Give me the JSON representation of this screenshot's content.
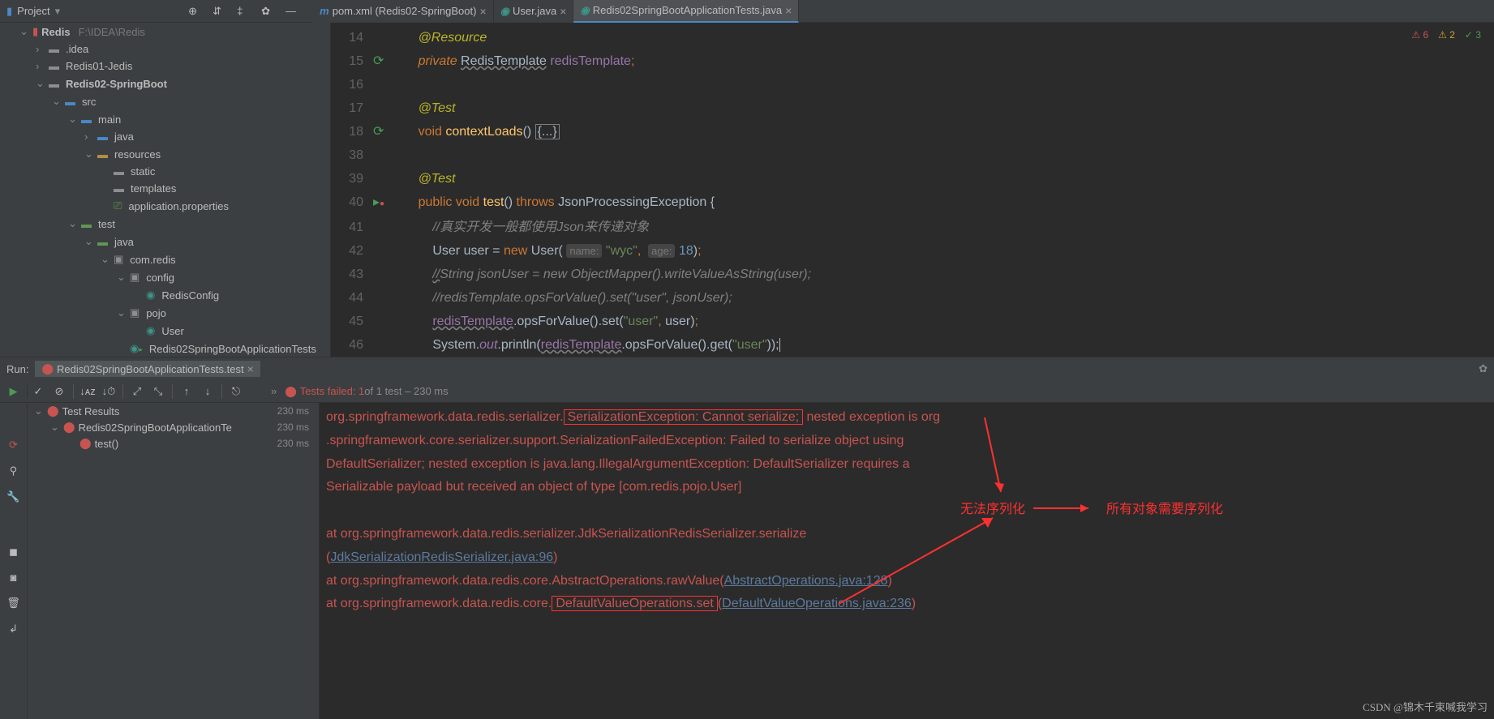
{
  "header": {
    "project_label": "Project"
  },
  "editor_tabs": [
    {
      "icon": "m",
      "label": "pom.xml (Redis02-SpringBoot)",
      "active": false
    },
    {
      "icon": "c",
      "label": "User.java",
      "active": false
    },
    {
      "icon": "c",
      "label": "Redis02SpringBootApplicationTests.java",
      "active": true
    }
  ],
  "tree": {
    "root": "Redis",
    "root_path": "F:\\IDEA\\Redis",
    "items": [
      {
        "indent": 2,
        "arrow": "›",
        "icon": "folder",
        "label": ".idea"
      },
      {
        "indent": 2,
        "arrow": "›",
        "icon": "folder",
        "label": "Redis01-Jedis"
      },
      {
        "indent": 2,
        "arrow": "⌄",
        "icon": "folder",
        "label": "Redis02-SpringBoot",
        "bold": true
      },
      {
        "indent": 3,
        "arrow": "⌄",
        "icon": "folder-blue",
        "label": "src"
      },
      {
        "indent": 4,
        "arrow": "⌄",
        "icon": "folder-blue",
        "label": "main"
      },
      {
        "indent": 5,
        "arrow": "›",
        "icon": "folder-blue",
        "label": "java"
      },
      {
        "indent": 5,
        "arrow": "⌄",
        "icon": "folder-gold",
        "label": "resources"
      },
      {
        "indent": 6,
        "arrow": "",
        "icon": "folder",
        "label": "static"
      },
      {
        "indent": 6,
        "arrow": "",
        "icon": "folder",
        "label": "templates"
      },
      {
        "indent": 6,
        "arrow": "",
        "icon": "prop",
        "label": "application.properties"
      },
      {
        "indent": 4,
        "arrow": "⌄",
        "icon": "folder-green",
        "label": "test"
      },
      {
        "indent": 5,
        "arrow": "⌄",
        "icon": "folder-green",
        "label": "java"
      },
      {
        "indent": 6,
        "arrow": "⌄",
        "icon": "pkg",
        "label": "com.redis"
      },
      {
        "indent": 7,
        "arrow": "⌄",
        "icon": "pkg",
        "label": "config"
      },
      {
        "indent": 8,
        "arrow": "",
        "icon": "class",
        "label": "RedisConfig"
      },
      {
        "indent": 7,
        "arrow": "⌄",
        "icon": "pkg",
        "label": "pojo"
      },
      {
        "indent": 8,
        "arrow": "",
        "icon": "class",
        "label": "User"
      },
      {
        "indent": 7,
        "arrow": "",
        "icon": "class-run",
        "label": "Redis02SpringBootApplicationTests"
      }
    ]
  },
  "inspections": {
    "errors": "6",
    "warnings": "2",
    "oks": "3"
  },
  "code_lines": [
    {
      "n": 14,
      "html": "<span class='kw-anno'>@Resource</span>"
    },
    {
      "n": 15,
      "icon": "sync",
      "html": "<span class='kw-orange' style='font-style:italic'>private</span> <span class='kw-white underline-wavy'>RedisTemplate</span> <span class='kw-purple'>redisTemplate</span><span class='kw-orange'>;</span>"
    },
    {
      "n": 16,
      "html": ""
    },
    {
      "n": 17,
      "html": "<span class='kw-anno'>@Test</span>"
    },
    {
      "n": 18,
      "icon": "sync",
      "html": "<span class='kw-orange'>void</span> <span class='kw-yellow'>contextLoads</span><span class='kw-white'>()</span> <span class='kw-white hl-box'>{...}</span>"
    },
    {
      "n": 38,
      "html": ""
    },
    {
      "n": 39,
      "html": "<span class='kw-anno'>@Test</span>"
    },
    {
      "n": 40,
      "icon": "run-err",
      "html": "<span class='kw-orange'>public void</span> <span class='kw-yellow'>test</span><span class='kw-white'>()</span> <span class='kw-orange'>throws</span> <span class='kw-white'>JsonProcessingException {</span>"
    },
    {
      "n": 41,
      "html": "    <span class='kw-comment'>//真实开发一般都使用Json来传递对象</span>"
    },
    {
      "n": 42,
      "html": "    <span class='kw-white'>User user =</span> <span class='kw-orange'>new</span> <span class='kw-white'>User(</span> <span class='param-hint'>name:</span> <span class='kw-green'>\"wyc\"</span><span class='kw-orange'>,</span>  <span class='param-hint'>age:</span> <span class='kw-blue'>18</span><span class='kw-white'>)</span><span class='kw-orange'>;</span>"
    },
    {
      "n": 43,
      "html": "    <span class='kw-comment underline-wavy'>//</span><span class='kw-comment'>String jsonUser = new ObjectMapper().writeValueAsString(user);</span>"
    },
    {
      "n": 44,
      "html": "    <span class='kw-comment'>//redisTemplate.opsForValue().set(\"user\", jsonUser);</span>"
    },
    {
      "n": 45,
      "html": "    <span class='kw-purple underline-wavy'>redisTemplate</span><span class='kw-white'>.opsForValue().set(</span><span class='kw-green'>\"user\"</span><span class='kw-orange'>,</span> <span class='kw-white'>user)</span><span class='kw-orange'>;</span>"
    },
    {
      "n": 46,
      "html": "    <span class='kw-white'>System.</span><span class='kw-purple' style='font-style:italic'>out</span><span class='kw-white'>.println(</span><span class='kw-purple underline-wavy'>redisTemplate</span><span class='kw-white'>.opsForValue().get(</span><span class='kw-green'>\"user\"</span><span class='kw-white'>));</span><span style='border-left:1px solid #bbb'>&nbsp;</span>"
    }
  ],
  "run": {
    "label": "Run:",
    "tab": "Redis02SpringBootApplicationTests.test",
    "status": "Tests failed: 1",
    "status_suffix": " of 1 test – 230 ms",
    "tests": [
      {
        "indent": 0,
        "arrow": "⌄",
        "icon": "err",
        "label": "Test Results",
        "time": "230 ms"
      },
      {
        "indent": 1,
        "arrow": "⌄",
        "icon": "err",
        "label": "Redis02SpringBootApplicationTe",
        "time": "230 ms"
      },
      {
        "indent": 2,
        "arrow": "",
        "icon": "err",
        "label": "test()",
        "time": "230 ms"
      }
    ],
    "console_lines": [
      "org.springframework.data.redis.serializer.<span class='red-box'>SerializationException: Cannot serialize;</span> nested exception is org",
      ".springframework.core.serializer.support.SerializationFailedException: Failed to serialize object using ",
      "DefaultSerializer; nested exception is java.lang.IllegalArgumentException: DefaultSerializer requires a ",
      "Serializable payload but received an object of type [com.redis.pojo.User]",
      "",
      "    at org.springframework.data.redis.serializer.JdkSerializationRedisSerializer.serialize",
      "(<span class='console-link'>JdkSerializationRedisSerializer.java:96</span>)",
      "    at org.springframework.data.redis.core.AbstractOperations.rawValue(<span class='console-link'>AbstractOperations.java:128</span>)",
      "    at org.springframework.data.redis.core.<span class='red-box'>DefaultValueOperations.set</span>(<span class='console-link'>DefaultValueOperations.java:236</span>)"
    ],
    "annotations": {
      "cannot_serialize": "无法序列化",
      "all_objects": "所有对象需要序列化"
    }
  },
  "watermark": "CSDN @锦木千束喊我学习"
}
